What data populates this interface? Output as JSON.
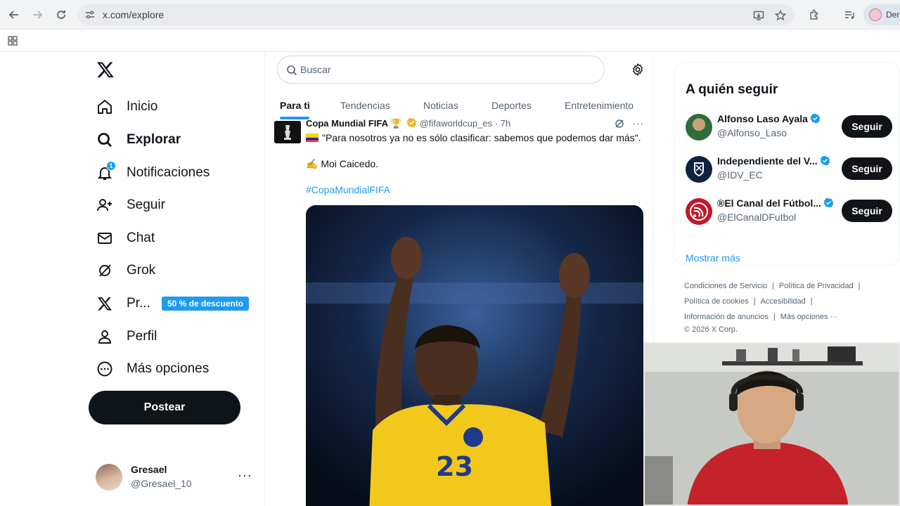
{
  "browser": {
    "url": "x.com/explore",
    "profile_name": "Den"
  },
  "nav": {
    "items": [
      {
        "label": "Inicio",
        "icon": "home-icon"
      },
      {
        "label": "Explorar",
        "icon": "search-icon"
      },
      {
        "label": "Notificaciones",
        "icon": "bell-icon"
      },
      {
        "label": "Seguir",
        "icon": "person-plus-icon"
      },
      {
        "label": "Chat",
        "icon": "envelope-icon"
      },
      {
        "label": "Grok",
        "icon": "grok-icon"
      },
      {
        "label": "Pr...",
        "icon": "x-logo-icon"
      },
      {
        "label": "Perfil",
        "icon": "person-icon"
      },
      {
        "label": "Más opciones",
        "icon": "more-circle-icon"
      }
    ],
    "notifications_count": "1",
    "premium_promo": "50 % de descuento",
    "post_button": "Postear",
    "account": {
      "name": "Gresael",
      "handle": "@Gresael_10",
      "more": "···"
    }
  },
  "search": {
    "placeholder": "Buscar"
  },
  "tabs": [
    "Para ti",
    "Tendencias",
    "Noticias",
    "Deportes",
    "Entretenimiento"
  ],
  "tweet": {
    "author": "Copa Mundial FIFA 🏆",
    "handle": "@fifaworldcup_es · 7h",
    "text1": "\"Para nosotros ya no es sólo clasificar: sabemos que podemos dar más\".",
    "text2": "✍️ Moi Caicedo.",
    "hashtag": "#CopaMundialFIFA",
    "more": "···",
    "jersey_number": "23"
  },
  "who_to_follow": {
    "title": "A quién seguir",
    "items": [
      {
        "name": "Alfonso Laso Ayala",
        "handle": "@Alfonso_Laso",
        "button": "Seguir"
      },
      {
        "name": "Independiente del V...",
        "handle": "@IDV_EC",
        "button": "Seguir"
      },
      {
        "name": "®El Canal del Fútbol...",
        "handle": "@ElCanalDFutbol",
        "button": "Seguir"
      }
    ],
    "show_more": "Mostrar más"
  },
  "footer": {
    "links": [
      "Condiciones de Servicio",
      "Política de Privacidad",
      "Política de cookies",
      "Accesibilidad",
      "Información de anuncios",
      "Más opciones ···"
    ],
    "copyright": "© 2026 X Corp."
  },
  "colors": {
    "accent": "#1d9bf0",
    "text": "#0f1419",
    "muted": "#536471"
  }
}
